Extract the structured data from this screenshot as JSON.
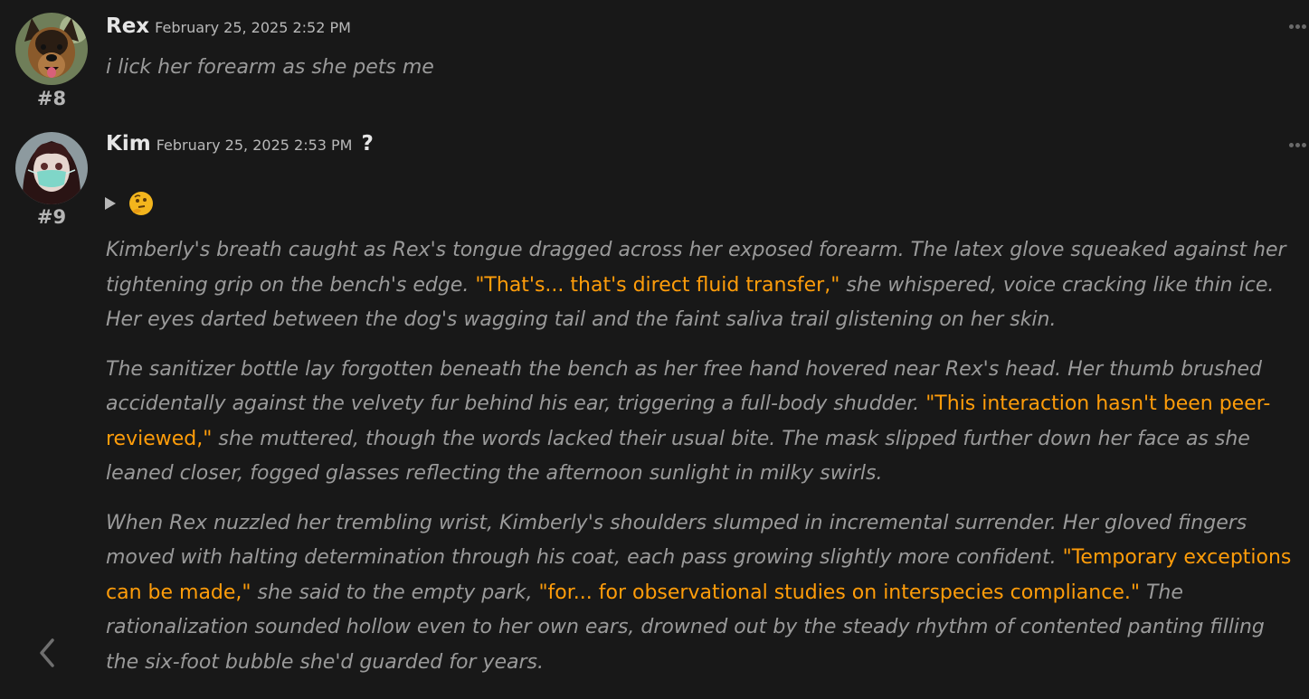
{
  "posts": [
    {
      "number": "#8",
      "author": "Rex",
      "date": "February 25, 2025 2:52 PM",
      "avatar": "german-shepherd-avatar",
      "text": "i lick her forearm as she pets me"
    },
    {
      "number": "#9",
      "author": "Kim",
      "date": "February 25, 2025 2:53 PM",
      "badge": "?",
      "avatar": "masked-girl-avatar",
      "reaction_icon": "thinking-face-emoji",
      "paragraphs": [
        {
          "before": "Kimberly's breath caught as Rex's tongue dragged across her exposed forearm. The latex glove squeaked against her tightening grip on the bench's edge. ",
          "quote": "\"That's... that's direct fluid transfer,\"",
          "after": " she whispered, voice cracking like thin ice. Her eyes darted between the dog's wagging tail and the faint saliva trail glistening on her skin."
        },
        {
          "before": "The sanitizer bottle lay forgotten beneath the bench as her free hand hovered near Rex's head. Her thumb brushed accidentally against the velvety fur behind his ear, triggering a full-body shudder. ",
          "quote": "\"This interaction hasn't been peer-reviewed,\"",
          "after": " she muttered, though the words lacked their usual bite. The mask slipped further down her face as she leaned closer, fogged glasses reflecting the afternoon sunlight in milky swirls."
        },
        {
          "before": "When Rex nuzzled her trembling wrist, Kimberly's shoulders slumped in incremental surrender. Her gloved fingers moved with halting determination through his coat, each pass growing slightly more confident. ",
          "quote": "\"Temporary exceptions can be made,\"",
          "middle": " she said to the empty park, ",
          "quote2": "\"for... for observational studies on interspecies compliance.\"",
          "after": " The rationalization sounded hollow even to her own ears, drowned out by the steady rhythm of contented panting filling the six-foot bubble she'd guarded for years."
        }
      ]
    }
  ],
  "colors": {
    "background": "#181818",
    "narration": "#9a9a9a",
    "dialogue": "#ff9d0a",
    "author": "#e6e6e6"
  }
}
